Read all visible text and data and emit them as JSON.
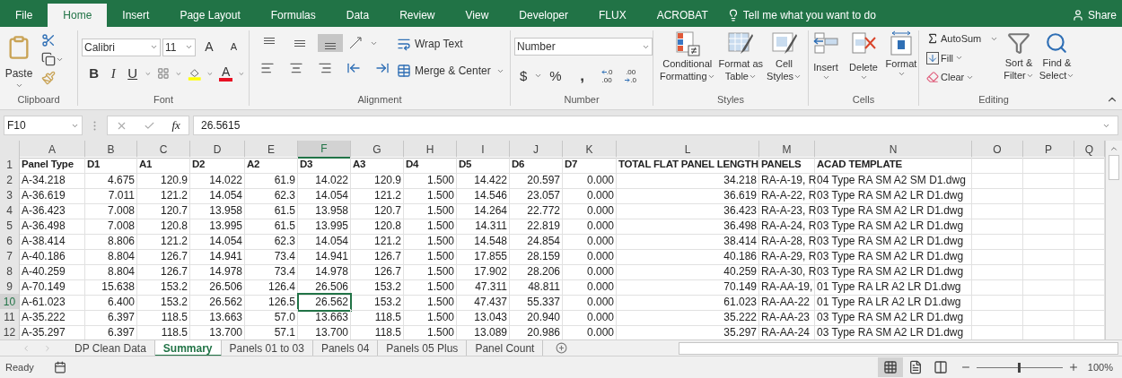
{
  "menu_tabs": [
    {
      "label": "File",
      "selected": false
    },
    {
      "label": "Home",
      "selected": true
    },
    {
      "label": "Insert",
      "selected": false
    },
    {
      "label": "Page Layout",
      "selected": false
    },
    {
      "label": "Formulas",
      "selected": false
    },
    {
      "label": "Data",
      "selected": false
    },
    {
      "label": "Review",
      "selected": false
    },
    {
      "label": "View",
      "selected": false
    },
    {
      "label": "Developer",
      "selected": false
    },
    {
      "label": "FLUX",
      "selected": false
    },
    {
      "label": "ACROBAT",
      "selected": false
    }
  ],
  "tell_me": "Tell me what you want to do",
  "share": "Share",
  "clipboard": {
    "title": "Clipboard",
    "paste": "Paste"
  },
  "font": {
    "title": "Font",
    "name": "Calibri",
    "size": "11",
    "grow": "A",
    "shrink": "A",
    "bold": "B",
    "italic": "I",
    "underline": "U",
    "font_color": "A"
  },
  "alignment": {
    "title": "Alignment",
    "vertical": [
      {
        "kind": "top",
        "selected": false
      },
      {
        "kind": "middle",
        "selected": false
      },
      {
        "kind": "bottom",
        "selected": true
      }
    ],
    "wrap_text": "Wrap Text",
    "merge_center": "Merge & Center"
  },
  "number": {
    "title": "Number",
    "format": "Number",
    "currency": "$",
    "percent": "%",
    "comma": ",",
    "increase_decimal": [
      ".0",
      ".00"
    ],
    "decrease_decimal": [
      ".00",
      ".0"
    ]
  },
  "styles": {
    "title": "Styles",
    "buttons": [
      {
        "kind": "conditional",
        "lines": [
          "Conditional",
          "Formatting"
        ]
      },
      {
        "kind": "table",
        "lines": [
          "Format as",
          "Table"
        ]
      },
      {
        "kind": "cell",
        "lines": [
          "Cell",
          "Styles"
        ]
      }
    ]
  },
  "cells": {
    "title": "Cells",
    "buttons": [
      {
        "kind": "insert",
        "label": "Insert"
      },
      {
        "kind": "delete",
        "label": "Delete"
      },
      {
        "kind": "format",
        "label": "Format"
      }
    ]
  },
  "editing": {
    "title": "Editing",
    "autosum": "AutoSum",
    "fill": "Fill",
    "clear": "Clear",
    "sort": [
      "Sort &",
      "Filter"
    ],
    "find": [
      "Find &",
      "Select"
    ]
  },
  "formula_bar": {
    "name_box": "F10",
    "fx": "fx",
    "value": "26.5615"
  },
  "columns": [
    {
      "label": "A",
      "kind": "text",
      "selected": false
    },
    {
      "label": "B",
      "kind": "number",
      "selected": false
    },
    {
      "label": "C",
      "kind": "number",
      "selected": false
    },
    {
      "label": "D",
      "kind": "number",
      "selected": false
    },
    {
      "label": "E",
      "kind": "number",
      "selected": false
    },
    {
      "label": "F",
      "kind": "number",
      "selected": true
    },
    {
      "label": "G",
      "kind": "number",
      "selected": false
    },
    {
      "label": "H",
      "kind": "number",
      "selected": false
    },
    {
      "label": "I",
      "kind": "number",
      "selected": false
    },
    {
      "label": "J",
      "kind": "number",
      "selected": false
    },
    {
      "label": "K",
      "kind": "number",
      "selected": false
    },
    {
      "label": "L",
      "kind": "number",
      "selected": false
    },
    {
      "label": "M",
      "kind": "text",
      "selected": false
    },
    {
      "label": "N",
      "kind": "text",
      "selected": false
    },
    {
      "label": "O",
      "kind": "text",
      "selected": false
    },
    {
      "label": "P",
      "kind": "text",
      "selected": false
    },
    {
      "label": "Q",
      "kind": "text",
      "selected": false
    }
  ],
  "rows": [
    {
      "label": "1",
      "kind": "header",
      "selected": false,
      "cells": [
        "Panel Type",
        "D1",
        "A1",
        "D2",
        "A2",
        "D3",
        "A3",
        "D4",
        "D5",
        "D6",
        "D7",
        "TOTAL FLAT PANEL LENGTH",
        "PANELS",
        "ACAD TEMPLATE"
      ]
    },
    {
      "label": "2",
      "kind": "data",
      "selected": false,
      "cells": [
        "A-34.218",
        "4.675",
        "120.9",
        "14.022",
        "61.9",
        "14.022",
        "120.9",
        "1.500",
        "14.422",
        "20.597",
        "0.000",
        "34.218",
        "RA-A-19, R",
        "04 Type RA SM A2 SM D1.dwg"
      ]
    },
    {
      "label": "3",
      "kind": "data",
      "selected": false,
      "cells": [
        "A-36.619",
        "7.011",
        "121.2",
        "14.054",
        "62.3",
        "14.054",
        "121.2",
        "1.500",
        "14.546",
        "23.057",
        "0.000",
        "36.619",
        "RA-A-22, R",
        "03 Type RA SM A2 LR D1.dwg"
      ]
    },
    {
      "label": "4",
      "kind": "data",
      "selected": false,
      "cells": [
        "A-36.423",
        "7.008",
        "120.7",
        "13.958",
        "61.5",
        "13.958",
        "120.7",
        "1.500",
        "14.264",
        "22.772",
        "0.000",
        "36.423",
        "RA-A-23, R",
        "03 Type RA SM A2 LR D1.dwg"
      ]
    },
    {
      "label": "5",
      "kind": "data",
      "selected": false,
      "cells": [
        "A-36.498",
        "7.008",
        "120.8",
        "13.995",
        "61.5",
        "13.995",
        "120.8",
        "1.500",
        "14.311",
        "22.819",
        "0.000",
        "36.498",
        "RA-A-24, R",
        "03 Type RA SM A2 LR D1.dwg"
      ]
    },
    {
      "label": "6",
      "kind": "data",
      "selected": false,
      "cells": [
        "A-38.414",
        "8.806",
        "121.2",
        "14.054",
        "62.3",
        "14.054",
        "121.2",
        "1.500",
        "14.548",
        "24.854",
        "0.000",
        "38.414",
        "RA-A-28, R",
        "03 Type RA SM A2 LR D1.dwg"
      ]
    },
    {
      "label": "7",
      "kind": "data",
      "selected": false,
      "cells": [
        "A-40.186",
        "8.804",
        "126.7",
        "14.941",
        "73.4",
        "14.941",
        "126.7",
        "1.500",
        "17.855",
        "28.159",
        "0.000",
        "40.186",
        "RA-A-29, R",
        "03 Type RA SM A2 LR D1.dwg"
      ]
    },
    {
      "label": "8",
      "kind": "data",
      "selected": false,
      "cells": [
        "A-40.259",
        "8.804",
        "126.7",
        "14.978",
        "73.4",
        "14.978",
        "126.7",
        "1.500",
        "17.902",
        "28.206",
        "0.000",
        "40.259",
        "RA-A-30, R",
        "03 Type RA SM A2 LR D1.dwg"
      ]
    },
    {
      "label": "9",
      "kind": "data",
      "selected": false,
      "cells": [
        "A-70.149",
        "15.638",
        "153.2",
        "26.506",
        "126.4",
        "26.506",
        "153.2",
        "1.500",
        "47.311",
        "48.811",
        "0.000",
        "70.149",
        "RA-AA-19,",
        "01 Type RA LR A2 LR D1.dwg"
      ]
    },
    {
      "label": "10",
      "kind": "data",
      "selected": true,
      "cells": [
        "A-61.023",
        "6.400",
        "153.2",
        "26.562",
        "126.5",
        "26.562",
        "153.2",
        "1.500",
        "47.437",
        "55.337",
        "0.000",
        "61.023",
        "RA-AA-22",
        "01 Type RA LR A2 LR D1.dwg"
      ]
    },
    {
      "label": "11",
      "kind": "data",
      "selected": false,
      "cells": [
        "A-35.222",
        "6.397",
        "118.5",
        "13.663",
        "57.0",
        "13.663",
        "118.5",
        "1.500",
        "13.043",
        "20.940",
        "0.000",
        "35.222",
        "RA-AA-23",
        "03 Type RA SM A2 LR D1.dwg"
      ]
    },
    {
      "label": "12",
      "kind": "data",
      "selected": false,
      "cells": [
        "A-35.297",
        "6.397",
        "118.5",
        "13.700",
        "57.1",
        "13.700",
        "118.5",
        "1.500",
        "13.089",
        "20.986",
        "0.000",
        "35.297",
        "RA-AA-24",
        "03 Type RA SM A2 LR D1.dwg"
      ]
    }
  ],
  "sheet_tabs": [
    {
      "label": "DP Clean Data",
      "selected": false
    },
    {
      "label": "Summary",
      "selected": true
    },
    {
      "label": "Panels 01 to 03",
      "selected": false
    },
    {
      "label": "Panels 04",
      "selected": false
    },
    {
      "label": "Panels 05 Plus",
      "selected": false
    },
    {
      "label": "Panel Count",
      "selected": false
    }
  ],
  "status_bar": {
    "status": "Ready",
    "views": [
      {
        "kind": "normal",
        "selected": true
      },
      {
        "kind": "page_layout",
        "selected": false
      },
      {
        "kind": "page_break",
        "selected": false
      }
    ],
    "zoom": {
      "level": 0.5,
      "reading": "100%"
    }
  }
}
